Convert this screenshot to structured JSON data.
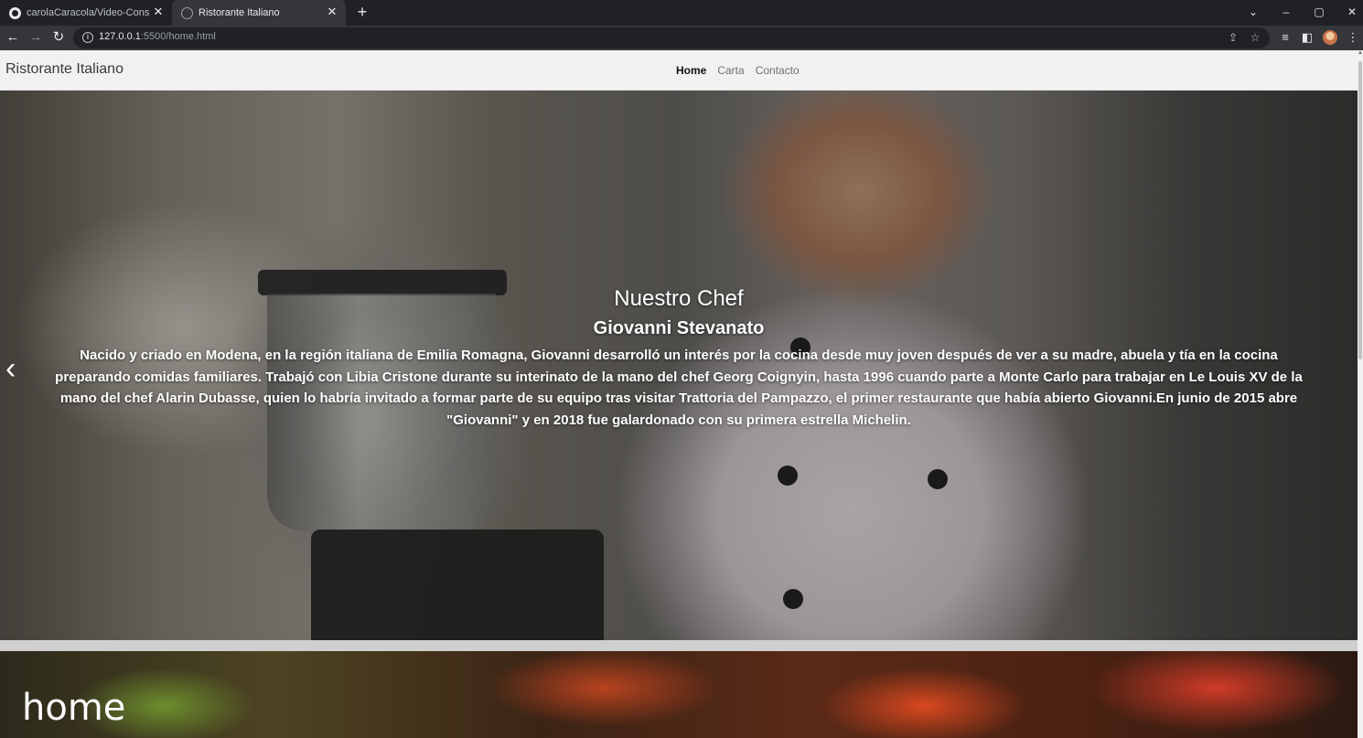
{
  "browser": {
    "tabs": [
      {
        "label": "carolaCaracola/Video-Consola-P",
        "active": false,
        "favicon": "github-icon"
      },
      {
        "label": "Ristorante Italiano",
        "active": true,
        "favicon": "globe-icon"
      }
    ],
    "url_host": "127.0.0.1",
    "url_rest": ":5500/home.html"
  },
  "site": {
    "brand": "Ristorante Italiano",
    "nav": [
      {
        "label": "Home",
        "active": true
      },
      {
        "label": "Carta",
        "active": false
      },
      {
        "label": "Contacto",
        "active": false
      }
    ]
  },
  "hero": {
    "title": "Nuestro Chef",
    "subtitle": "Giovanni Stevanato",
    "text": "Nacido y criado en Modena, en la región italiana de Emilia Romagna, Giovanni desarrolló un interés por la cocina desde muy joven después de ver a su madre, abuela y tía en la cocina preparando comidas familiares. Trabajó con Libia Cristone durante su interinato de la mano del chef Georg Coignyin, hasta 1996 cuando parte a Monte Carlo para trabajar en Le Louis XV de la mano del chef Alarin Dubasse, quien lo habría invitado a formar parte de su equipo tras visitar Trattoria del Pampazzo, el primer restaurante que había abierto Giovanni.En junio de 2015 abre \"Giovanni\" y en 2018 fue galardonado con su primera estrella Michelin.",
    "prev_icon": "chevron-left-icon"
  },
  "overlay_label": "home",
  "colors": {
    "chrome_bg": "#202124",
    "toolbar_bg": "#35363a",
    "navbar_bg": "#f1f1f1"
  }
}
